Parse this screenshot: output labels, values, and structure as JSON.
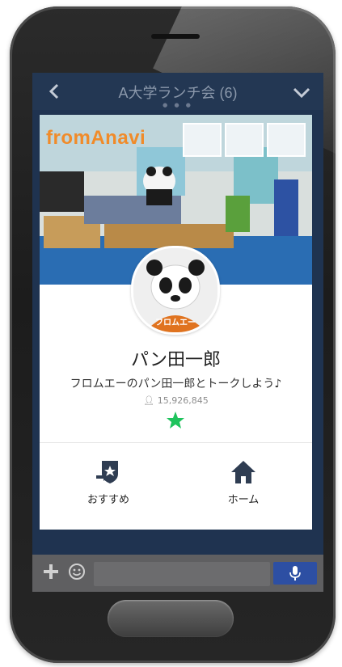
{
  "header": {
    "title": "A大学ランチ会 (6)",
    "page_dots": "● ● ●"
  },
  "profile": {
    "cover_logo": "fromAnavi",
    "name": "パン田一郎",
    "status_message": "フロムエーのパン田一郎とトークしよう♪",
    "friend_count": "15,926,845",
    "avatar_badge": "フロムエー"
  },
  "actions": [
    {
      "label": "おすすめ",
      "icon": "recommend-icon"
    },
    {
      "label": "ホーム",
      "icon": "home-icon"
    }
  ],
  "colors": {
    "header_bg": "#233753",
    "accent_green": "#1ec35c",
    "logo_orange": "#f08b2a",
    "mic_blue": "#2d4fa3"
  }
}
